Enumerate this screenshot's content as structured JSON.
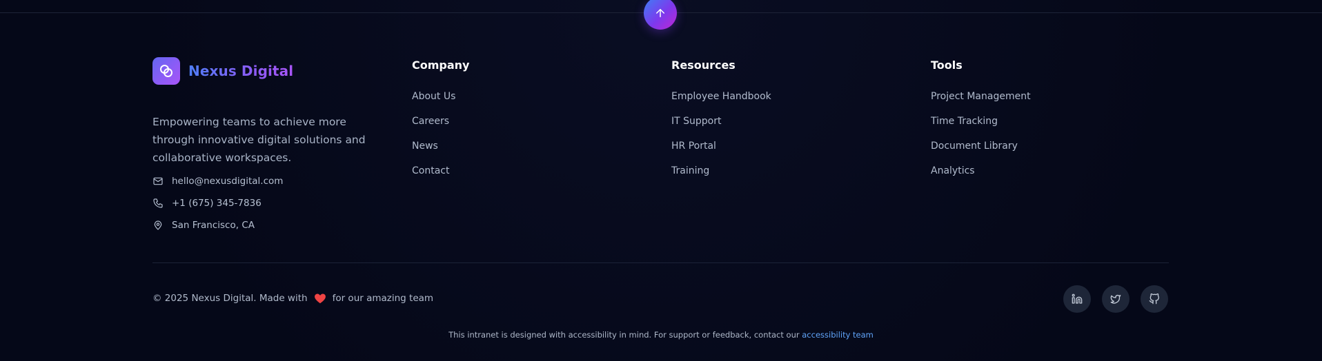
{
  "brand": {
    "name": "Nexus Digital",
    "tagline": "Empowering teams to achieve more through innovative digital solutions and collaborative workspaces."
  },
  "contact": {
    "email": "hello@nexusdigital.com",
    "phone": "+1 (675) 345-7836",
    "location": "San Francisco, CA"
  },
  "columns": [
    {
      "title": "Company",
      "links": [
        "About Us",
        "Careers",
        "News",
        "Contact"
      ]
    },
    {
      "title": "Resources",
      "links": [
        "Employee Handbook",
        "IT Support",
        "HR Portal",
        "Training"
      ]
    },
    {
      "title": "Tools",
      "links": [
        "Project Management",
        "Time Tracking",
        "Document Library",
        "Analytics"
      ]
    }
  ],
  "bottom": {
    "copyright_prefix": "© 2025 Nexus Digital. Made with",
    "copyright_suffix": "for our amazing team",
    "accessibility_text": "This intranet is designed with accessibility in mind. For support or feedback, contact our",
    "accessibility_link": "accessibility team"
  },
  "social": [
    "linkedin-icon",
    "twitter-icon",
    "github-icon"
  ],
  "icons": {
    "scroll_top": "arrow-up-icon",
    "logo": "overlapping-circles-icon",
    "email": "mail-icon",
    "phone": "phone-icon",
    "location": "map-pin-icon",
    "heart": "heart-icon"
  },
  "colors": {
    "background": "#050818",
    "accent_blue": "#3b82f6",
    "accent_purple": "#8b5cf6",
    "heart_red": "#ef4444",
    "link_blue": "#60a5fa"
  }
}
